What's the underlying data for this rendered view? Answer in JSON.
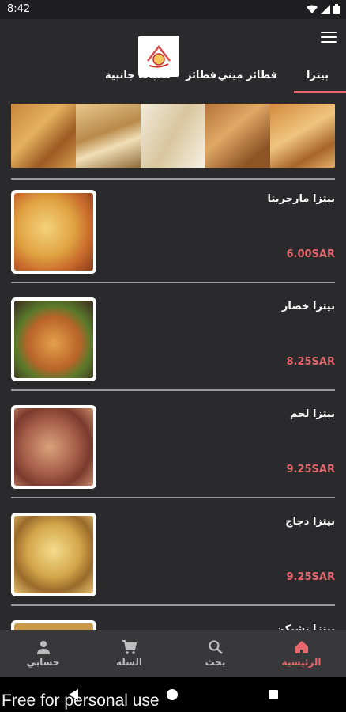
{
  "status_bar": {
    "time": "8:42"
  },
  "tabs": [
    {
      "label": "بيتزا",
      "active": true
    },
    {
      "label": "فطائر ميني",
      "active": false
    },
    {
      "label": "فطائر",
      "active": false
    },
    {
      "label": "طلبات جانبية",
      "active": false
    }
  ],
  "menu_items": [
    {
      "name": "بيتزا مارجريتا",
      "price": "6.00SAR"
    },
    {
      "name": "بيتزا خضار",
      "price": "8.25SAR"
    },
    {
      "name": "بيتزا لحم",
      "price": "9.25SAR"
    },
    {
      "name": "بيتزا دجاج",
      "price": "9.25SAR"
    },
    {
      "name": "بيتزا تشيكن",
      "price": ""
    }
  ],
  "bottom_nav": [
    {
      "label": "حسابي",
      "icon": "person-icon",
      "active": false
    },
    {
      "label": "السلة",
      "icon": "cart-icon",
      "active": false
    },
    {
      "label": "بحث",
      "icon": "search-icon",
      "active": false
    },
    {
      "label": "الرئيسية",
      "icon": "home-icon",
      "active": true
    }
  ],
  "watermark": "Free for personal use",
  "colors": {
    "accent": "#e5676d",
    "background": "#2a2a2d",
    "nav_bg": "#38383b"
  }
}
